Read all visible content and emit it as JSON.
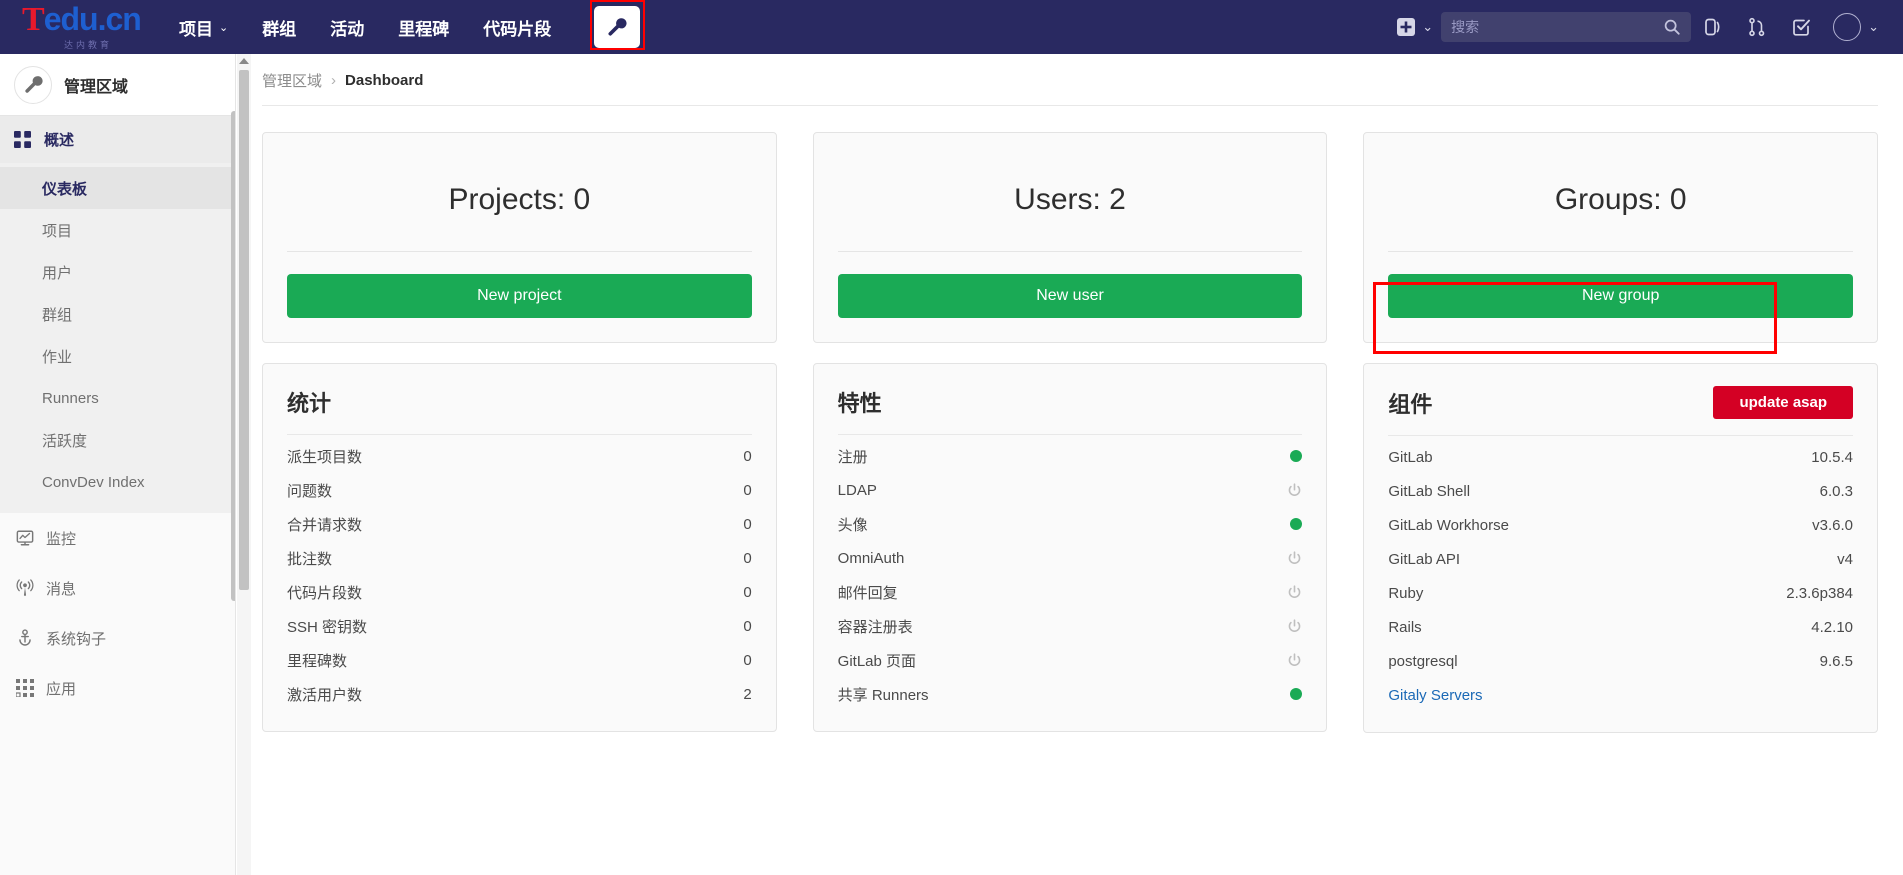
{
  "topnav": {
    "logo": {
      "brand_t": "T",
      "brand_edu": "edu.cn",
      "sub": "达内教育",
      "color_red": "#e8192c",
      "color_blue": "#1e5fd0"
    },
    "items": [
      {
        "label": "项目",
        "has_caret": true
      },
      {
        "label": "群组",
        "has_caret": false
      },
      {
        "label": "活动",
        "has_caret": false
      },
      {
        "label": "里程碑",
        "has_caret": false
      },
      {
        "label": "代码片段",
        "has_caret": false
      }
    ],
    "admin_tab": {
      "icon": "wrench-icon",
      "highlighted": true
    },
    "plus": {
      "icon": "plus-square-icon",
      "caret": "⌄"
    },
    "search": {
      "placeholder": "搜索",
      "value": "",
      "icon": "search-icon"
    },
    "right_icons": [
      {
        "name": "issues-icon"
      },
      {
        "name": "merge-requests-icon"
      },
      {
        "name": "todos-icon"
      }
    ],
    "avatar": {
      "name": "user-avatar",
      "caret": "⌄"
    },
    "bg_color": "#292961"
  },
  "sidebar": {
    "title": "管理区域",
    "header_icon": "wrench-icon",
    "section": {
      "label": "概述",
      "icon": "grid-icon"
    },
    "sub_items": [
      {
        "label": "仪表板",
        "active": true
      },
      {
        "label": "项目",
        "active": false
      },
      {
        "label": "用户",
        "active": false
      },
      {
        "label": "群组",
        "active": false
      },
      {
        "label": "作业",
        "active": false
      },
      {
        "label": "Runners",
        "active": false
      },
      {
        "label": "活跃度",
        "active": false
      },
      {
        "label": "ConvDev Index",
        "active": false
      }
    ],
    "items": [
      {
        "label": "监控",
        "icon": "monitor-icon"
      },
      {
        "label": "消息",
        "icon": "broadcast-icon"
      },
      {
        "label": "系统钩子",
        "icon": "hook-icon"
      },
      {
        "label": "应用",
        "icon": "apps-icon"
      }
    ]
  },
  "breadcrumb": {
    "root": "管理区域",
    "separator": "›",
    "current": "Dashboard"
  },
  "cards": {
    "projects": {
      "title": "Projects: 0",
      "button": "New project"
    },
    "users": {
      "title": "Users: 2",
      "button": "New user"
    },
    "groups": {
      "title": "Groups: 0",
      "button": "New group",
      "highlighted": true
    }
  },
  "statistics": {
    "title": "统计",
    "rows": [
      {
        "label": "派生项目数",
        "value": "0"
      },
      {
        "label": "问题数",
        "value": "0"
      },
      {
        "label": "合并请求数",
        "value": "0"
      },
      {
        "label": "批注数",
        "value": "0"
      },
      {
        "label": "代码片段数",
        "value": "0"
      },
      {
        "label": "SSH 密钥数",
        "value": "0"
      },
      {
        "label": "里程碑数",
        "value": "0"
      },
      {
        "label": "激活用户数",
        "value": "2"
      }
    ]
  },
  "features": {
    "title": "特性",
    "rows": [
      {
        "label": "注册",
        "status": "on"
      },
      {
        "label": "LDAP",
        "status": "off"
      },
      {
        "label": "头像",
        "status": "on"
      },
      {
        "label": "OmniAuth",
        "status": "off"
      },
      {
        "label": "邮件回复",
        "status": "off"
      },
      {
        "label": "容器注册表",
        "status": "off"
      },
      {
        "label": "GitLab 页面",
        "status": "off"
      },
      {
        "label": "共享 Runners",
        "status": "on"
      }
    ],
    "on_color": "#1aaa55",
    "off_color": "#bfbfbf"
  },
  "components": {
    "title": "组件",
    "badge": {
      "label": "update asap",
      "color": "#d40024"
    },
    "rows": [
      {
        "label": "GitLab",
        "value": "10.5.4",
        "is_link": false
      },
      {
        "label": "GitLab Shell",
        "value": "6.0.3",
        "is_link": false
      },
      {
        "label": "GitLab Workhorse",
        "value": "v3.6.0",
        "is_link": false
      },
      {
        "label": "GitLab API",
        "value": "v4",
        "is_link": false
      },
      {
        "label": "Ruby",
        "value": "2.3.6p384",
        "is_link": false
      },
      {
        "label": "Rails",
        "value": "4.2.10",
        "is_link": false
      },
      {
        "label": "postgresql",
        "value": "9.6.5",
        "is_link": false
      },
      {
        "label": "Gitaly Servers",
        "value": "",
        "is_link": true
      }
    ]
  },
  "colors": {
    "accent_green": "#1aaa55",
    "nav_bg": "#292961",
    "danger_red": "#d40024",
    "highlight_red": "#ff0000"
  }
}
